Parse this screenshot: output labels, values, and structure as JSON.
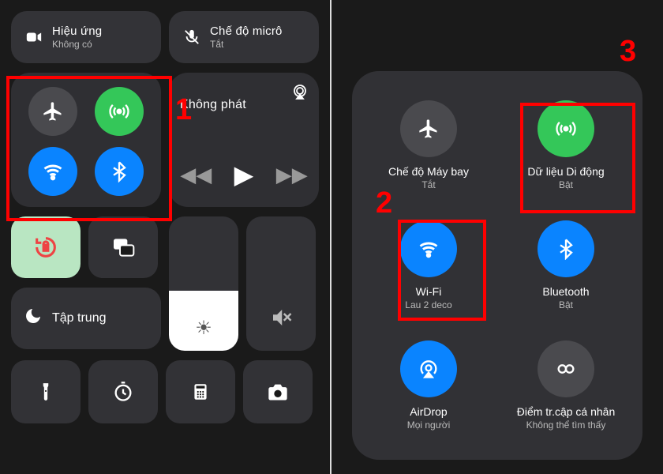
{
  "annotations": {
    "one": "1",
    "two": "2",
    "three": "3"
  },
  "left": {
    "effects": {
      "label": "Hiệu ứng",
      "sub": "Không có"
    },
    "mic": {
      "label": "Chế độ micrô",
      "sub": "Tắt"
    },
    "media": {
      "title": "Không phát"
    },
    "focus": {
      "label": "Tập trung"
    }
  },
  "right": {
    "airplane": {
      "label": "Chế độ Máy bay",
      "sub": "Tắt"
    },
    "cellular": {
      "label": "Dữ liệu Di động",
      "sub": "Bật"
    },
    "wifi": {
      "label": "Wi-Fi",
      "sub": "Lau 2 deco"
    },
    "bluetooth": {
      "label": "Bluetooth",
      "sub": "Bật"
    },
    "airdrop": {
      "label": "AirDrop",
      "sub": "Mọi người"
    },
    "hotspot": {
      "label": "Điểm tr.cập cá nhân",
      "sub": "Không thể tìm thấy"
    }
  }
}
